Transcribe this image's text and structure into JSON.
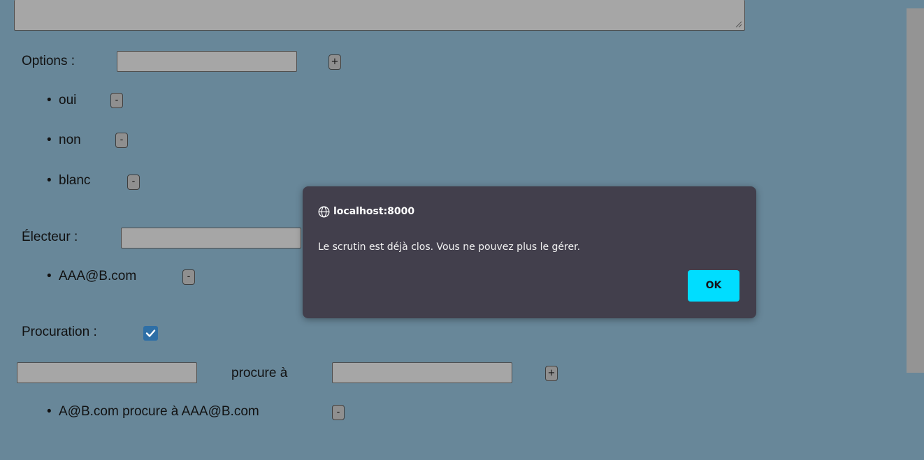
{
  "form": {
    "options_label": "Options :",
    "add_symbol": "+",
    "remove_symbol": "-",
    "options": [
      "oui",
      "non",
      "blanc"
    ],
    "electeur_label": "Électeur :",
    "electeurs": [
      "AAA@B.com"
    ],
    "procuration_label": "Procuration :",
    "procuration_checked": true,
    "procure_a_label": "procure à",
    "procurations": [
      "A@B.com procure à AAA@B.com"
    ]
  },
  "dialog": {
    "origin": "localhost:8000",
    "origin_icon": "globe-icon",
    "message": "Le scrutin est déjà clos. Vous ne pouvez plus le gérer.",
    "ok_label": "OK"
  },
  "colors": {
    "page_background": "#688799",
    "dialog_background": "#423f4c",
    "ok_button": "#00ddff"
  }
}
